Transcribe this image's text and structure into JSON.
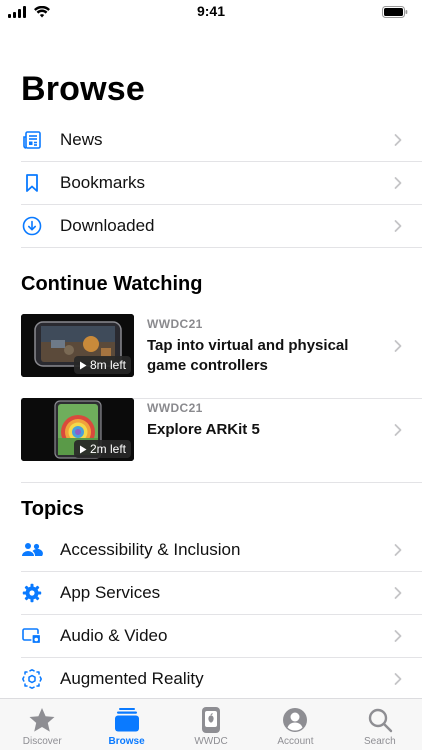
{
  "status": {
    "time": "9:41"
  },
  "page": {
    "title": "Browse"
  },
  "browse_links": [
    {
      "label": "News",
      "icon": "newspaper-icon"
    },
    {
      "label": "Bookmarks",
      "icon": "bookmark-icon"
    },
    {
      "label": "Downloaded",
      "icon": "download-icon"
    }
  ],
  "continue_watching": {
    "title": "Continue Watching",
    "items": [
      {
        "event": "WWDC21",
        "title": "Tap into virtual and physical game controllers",
        "time_left": "8m left"
      },
      {
        "event": "WWDC21",
        "title": "Explore ARKit 5",
        "time_left": "2m left"
      }
    ]
  },
  "topics": {
    "title": "Topics",
    "items": [
      {
        "label": "Accessibility & Inclusion",
        "icon": "people-icon"
      },
      {
        "label": "App Services",
        "icon": "gear-icon"
      },
      {
        "label": "Audio & Video",
        "icon": "audio-video-icon"
      },
      {
        "label": "Augmented Reality",
        "icon": "ar-icon"
      }
    ]
  },
  "tabs": [
    {
      "label": "Discover",
      "icon": "star-icon",
      "active": false
    },
    {
      "label": "Browse",
      "icon": "stack-icon",
      "active": true
    },
    {
      "label": "WWDC",
      "icon": "wwdc-icon",
      "active": false
    },
    {
      "label": "Account",
      "icon": "person-icon",
      "active": false
    },
    {
      "label": "Search",
      "icon": "search-icon",
      "active": false
    }
  ],
  "colors": {
    "accent": "#0A7AFF",
    "secondary_text": "#8A8A8E",
    "separator": "#E3E3E6"
  }
}
